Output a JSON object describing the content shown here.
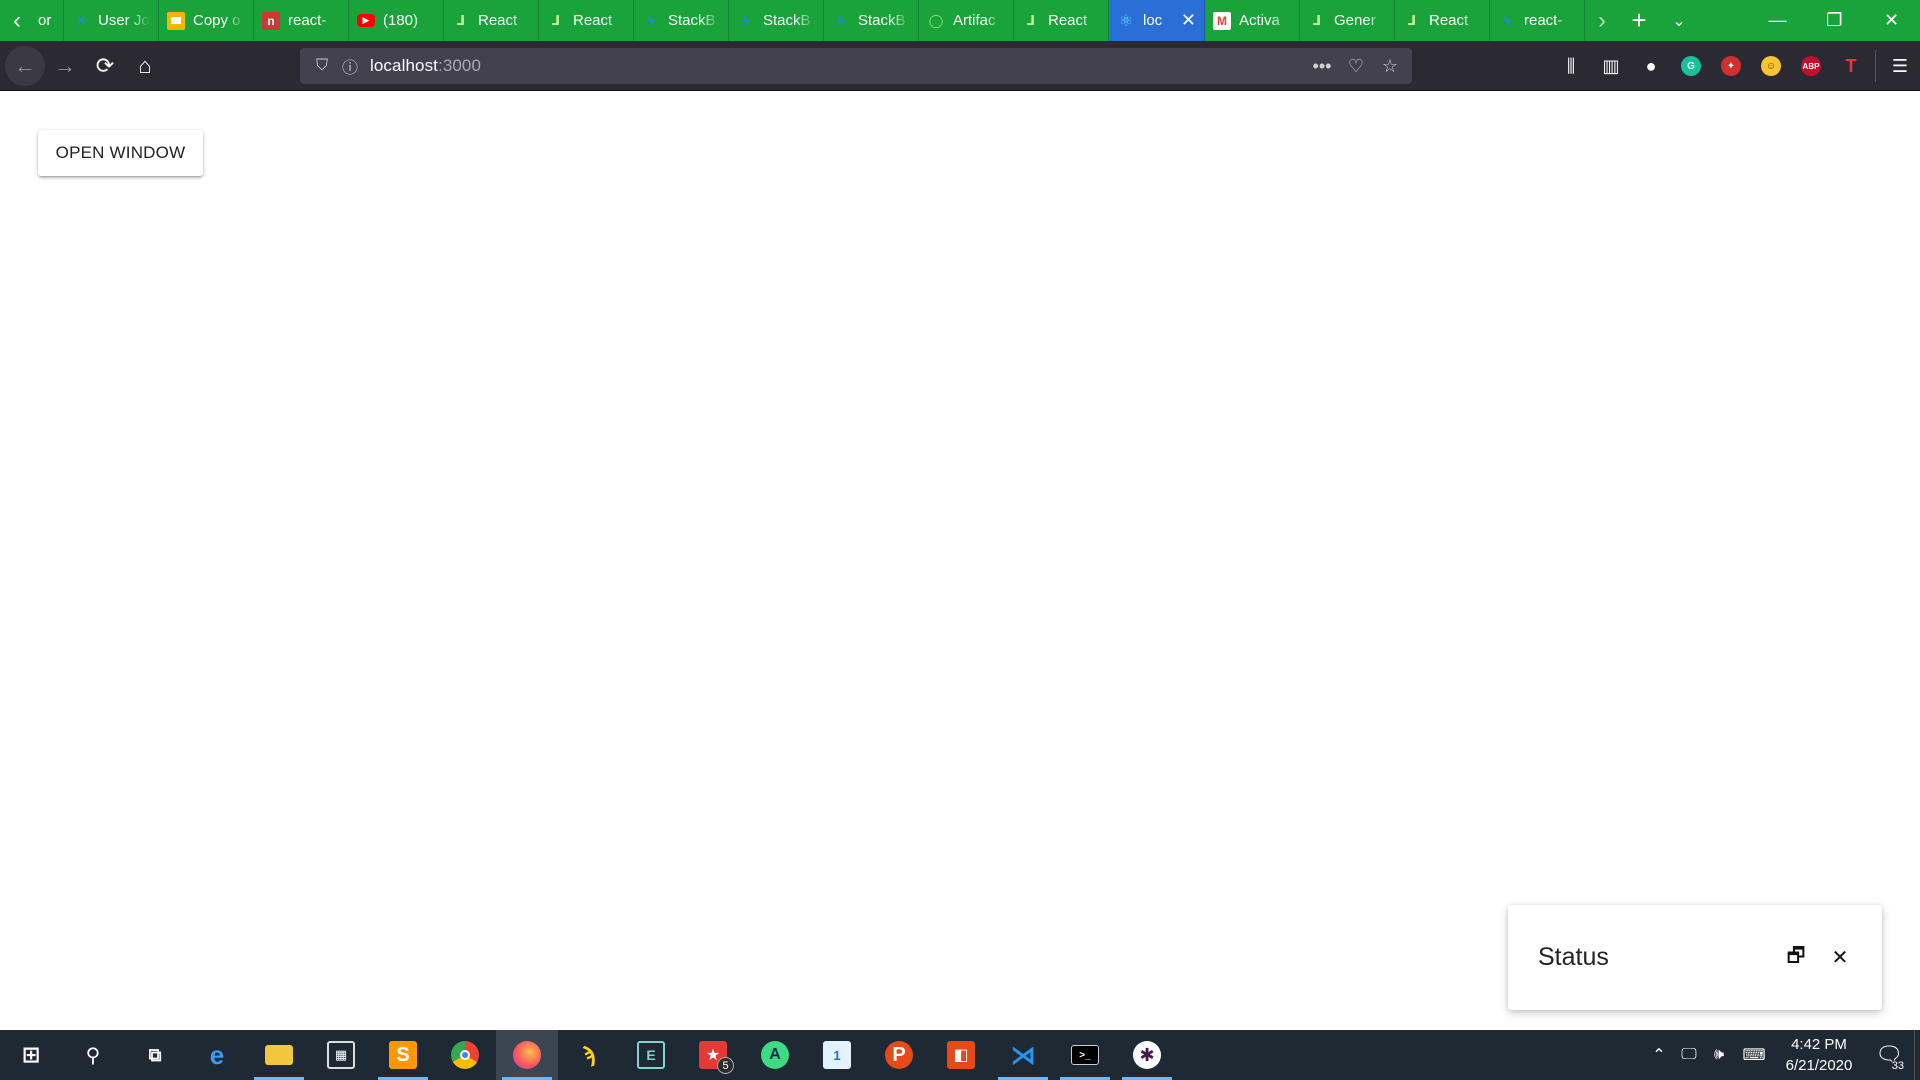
{
  "browser": {
    "tabs": [
      {
        "title": "or",
        "icon": "tab-favicon",
        "color": "#1aa33a"
      },
      {
        "title": "User Jo",
        "icon": "confluence-favicon",
        "color": "#2684ff"
      },
      {
        "title": "Copy o",
        "icon": "slides-favicon",
        "color": "#f4b400"
      },
      {
        "title": "react-",
        "icon": "npm-favicon",
        "color": "#cb3837"
      },
      {
        "title": "(180) ",
        "icon": "youtube-favicon",
        "color": "#ff0000"
      },
      {
        "title": "React",
        "icon": "react-spring-favicon",
        "color": "#9be564"
      },
      {
        "title": "React",
        "icon": "react-spring-favicon",
        "color": "#9be564"
      },
      {
        "title": "StackB",
        "icon": "stackblitz-favicon",
        "color": "#1389fd"
      },
      {
        "title": "StackB",
        "icon": "stackblitz-favicon",
        "color": "#1389fd"
      },
      {
        "title": "StackB",
        "icon": "stackblitz-favicon",
        "color": "#1389fd"
      },
      {
        "title": "Artifac",
        "icon": "artifactory-favicon",
        "color": "#40be46"
      },
      {
        "title": "React",
        "icon": "react-spring-favicon",
        "color": "#9be564"
      },
      {
        "title": "loc",
        "icon": "react-favicon",
        "color": "#61dafb",
        "active": true
      },
      {
        "title": "Activa",
        "icon": "gmail-favicon",
        "color": "#ea4335"
      },
      {
        "title": "Gener",
        "icon": "react-spring-favicon",
        "color": "#9be564"
      },
      {
        "title": "React",
        "icon": "react-spring-favicon",
        "color": "#9be564"
      },
      {
        "title": "react-",
        "icon": "stackblitz-favicon",
        "color": "#1389fd"
      }
    ],
    "url": {
      "host": "localhost",
      "port": ":3000"
    },
    "accent": "#1aa33a"
  },
  "page": {
    "open_button_label": "OPEN WINDOW",
    "status_window": {
      "title": "Status"
    }
  },
  "taskbar": {
    "clock_time": "4:42 PM",
    "clock_date": "6/21/2020",
    "badge_count": "5",
    "notification_count": "33"
  }
}
